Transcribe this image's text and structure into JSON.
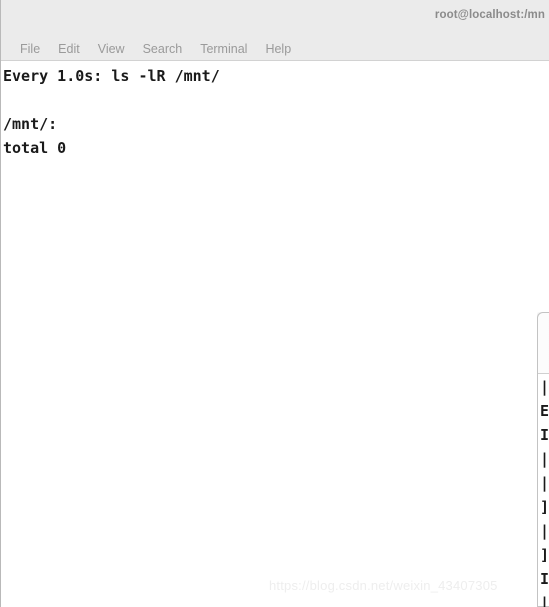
{
  "window": {
    "title": "root@localhost:/mn",
    "menu": [
      {
        "label": "File"
      },
      {
        "label": "Edit"
      },
      {
        "label": "View"
      },
      {
        "label": "Search"
      },
      {
        "label": "Terminal"
      },
      {
        "label": "Help"
      }
    ]
  },
  "terminal": {
    "lines": [
      {
        "text": "Every 1.0s: ls -lR /mnt/"
      },
      {
        "text": " "
      },
      {
        "text": "/mnt/:"
      },
      {
        "text": "total 0"
      }
    ]
  },
  "second_window": {
    "lines": [
      {
        "text": "|"
      },
      {
        "text": "E"
      },
      {
        "text": "I"
      },
      {
        "text": "|"
      },
      {
        "text": "|"
      },
      {
        "text": "]"
      },
      {
        "text": "|"
      },
      {
        "text": "]"
      },
      {
        "text": "I"
      },
      {
        "text": "|"
      }
    ]
  },
  "watermark": {
    "text": "https://blog.csdn.net/weixin_43407305"
  },
  "colors": {
    "chrome": "#ebebeb",
    "menu_text": "#9a9a9a",
    "title_text": "#8b8b8b",
    "terminal_bg": "#ffffff",
    "terminal_text": "#1a1a1a",
    "watermark": "#eeeeee"
  }
}
